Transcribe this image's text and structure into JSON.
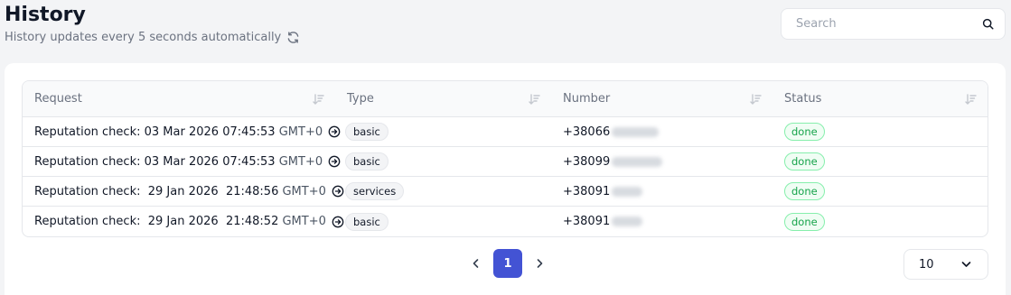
{
  "header": {
    "title": "History",
    "subtitle": "History updates every 5 seconds automatically"
  },
  "search": {
    "placeholder": "Search",
    "value": ""
  },
  "table": {
    "columns": [
      "Request",
      "Type",
      "Number",
      "Status"
    ],
    "rows": [
      {
        "prefix": "Reputation check:",
        "date": "03 Mar 2026",
        "time": "07:45:53",
        "tz": "GMT+0",
        "type": "basic",
        "number": "+38066",
        "status": "done"
      },
      {
        "prefix": "Reputation check:",
        "date": "03 Mar 2026",
        "time": "07:45:53",
        "tz": "GMT+0",
        "type": "basic",
        "number": "+38099",
        "status": "done"
      },
      {
        "prefix": "Reputation check:",
        "date": "29 Jan 2026",
        "time": "21:48:56",
        "tz": "GMT+0",
        "type": "services",
        "number": "+38091",
        "status": "done"
      },
      {
        "prefix": "Reputation check:",
        "date": "29 Jan 2026",
        "time": "21:48:52",
        "tz": "GMT+0",
        "type": "basic",
        "number": "+38091",
        "status": "done"
      }
    ]
  },
  "pagination": {
    "current": "1"
  },
  "page_size": {
    "value": "10"
  },
  "colors": {
    "accent": "#4353d4",
    "status_done": "#16a34a",
    "background": "#f3f4f6"
  }
}
